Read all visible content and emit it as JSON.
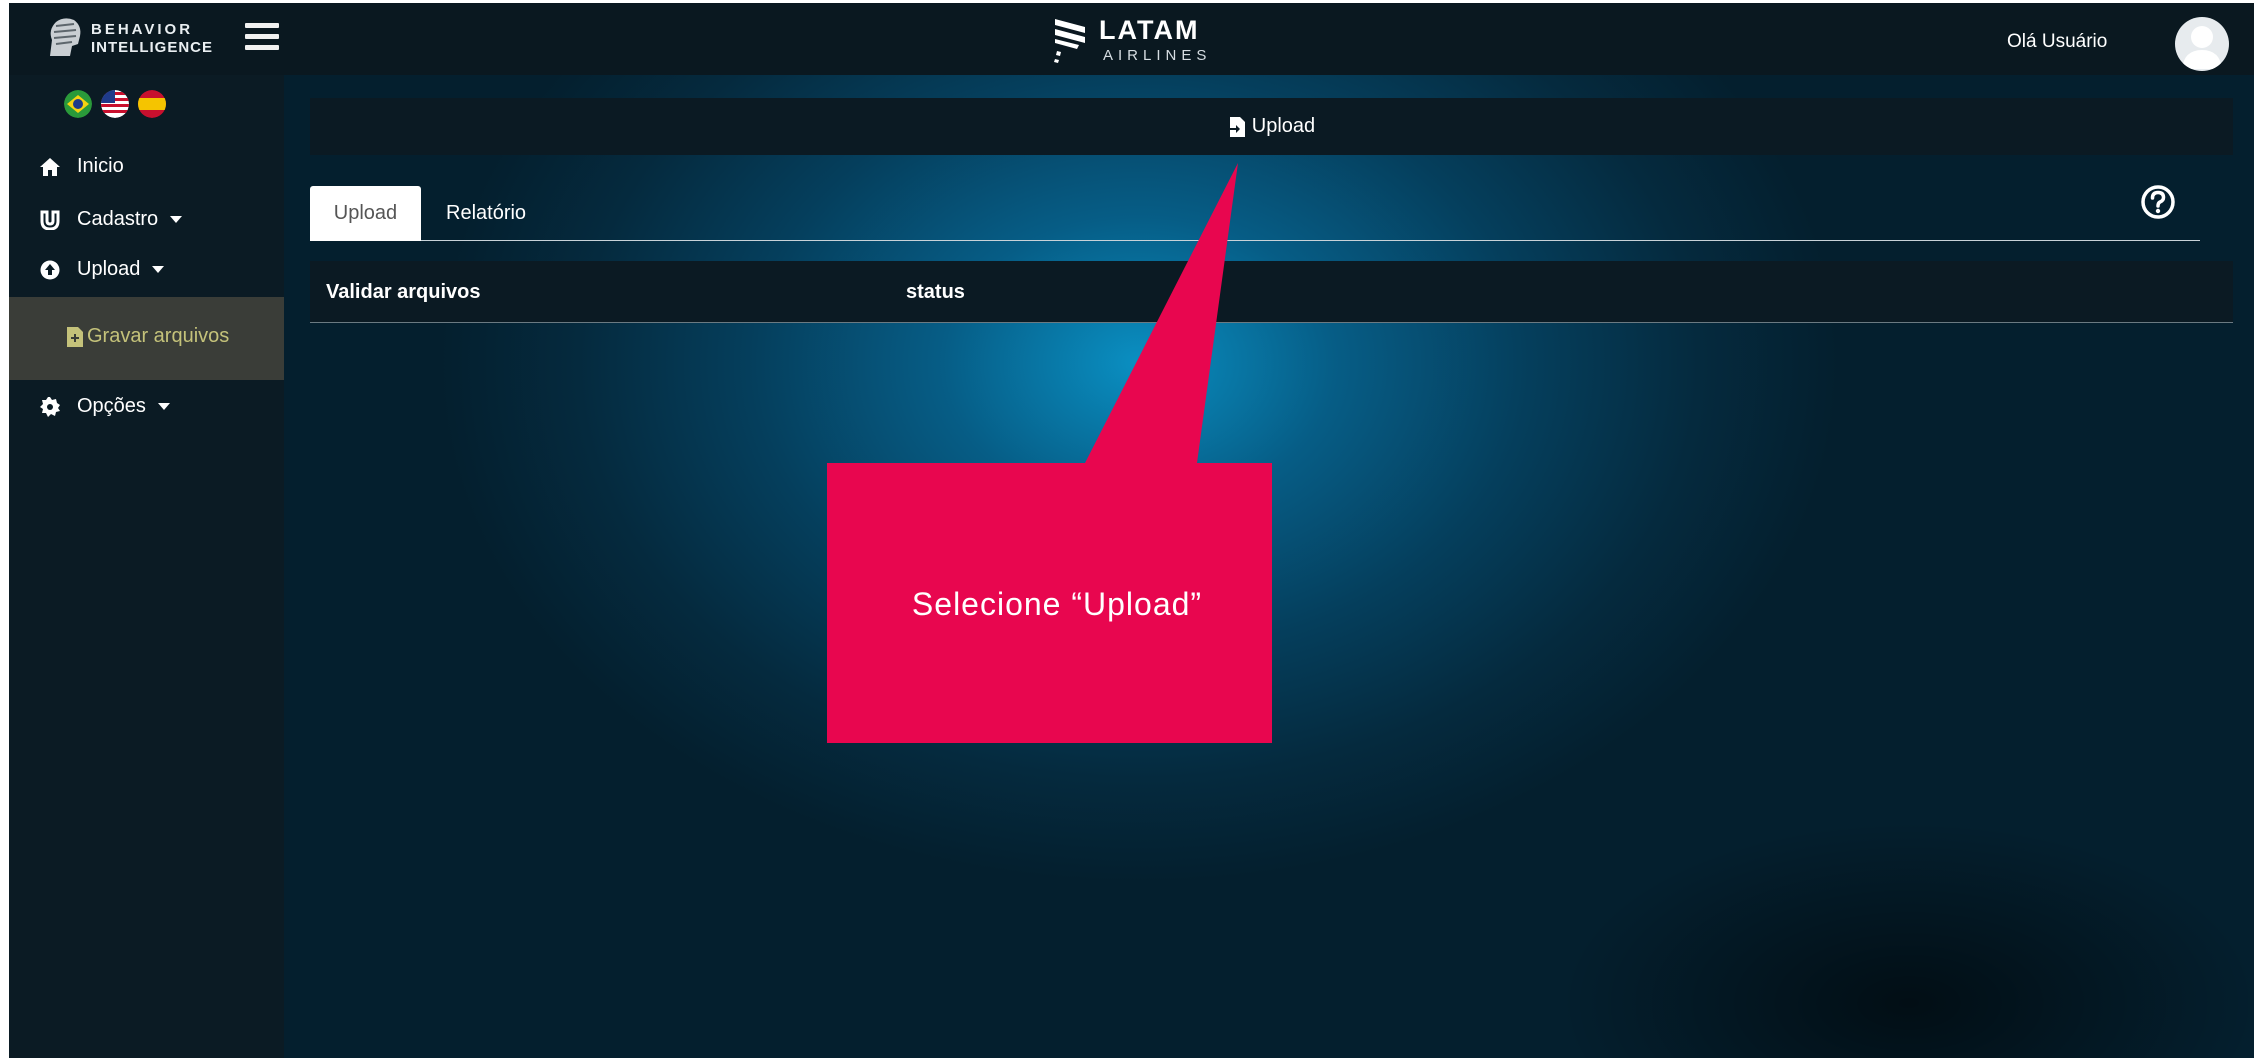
{
  "header": {
    "brand_line1": "BEHAVIOR",
    "brand_line2": "INTELLIGENCE",
    "airline_name": "LATAM",
    "airline_sub": "AIRLINES",
    "greeting": "Olá Usuário"
  },
  "languages": [
    {
      "code": "pt-BR",
      "icon": "brazil-flag-icon"
    },
    {
      "code": "en-US",
      "icon": "usa-flag-icon"
    },
    {
      "code": "es",
      "icon": "spain-flag-icon"
    }
  ],
  "sidebar": {
    "items": [
      {
        "label": "Inicio",
        "icon": "home-icon"
      },
      {
        "label": "Cadastro",
        "icon": "magnet-icon"
      },
      {
        "label": "Upload",
        "icon": "upload-circle-icon"
      },
      {
        "label": "Gravar arquivos",
        "icon": "file-icon",
        "active": true
      },
      {
        "label": "Opções",
        "icon": "gear-icon"
      }
    ]
  },
  "main": {
    "section_title": "Upload",
    "tabs": [
      {
        "label": "Upload",
        "active": true
      },
      {
        "label": "Relatório",
        "active": false
      }
    ],
    "table": {
      "columns": [
        "Validar arquivos",
        "status"
      ]
    }
  },
  "callout": {
    "text": "Selecione “Upload”",
    "color": "#e8064f"
  },
  "colors": {
    "sidebar_bg": "#0b1b24",
    "active_submenu_text": "#c4c27a",
    "bar_bg": "#0b1a23"
  }
}
